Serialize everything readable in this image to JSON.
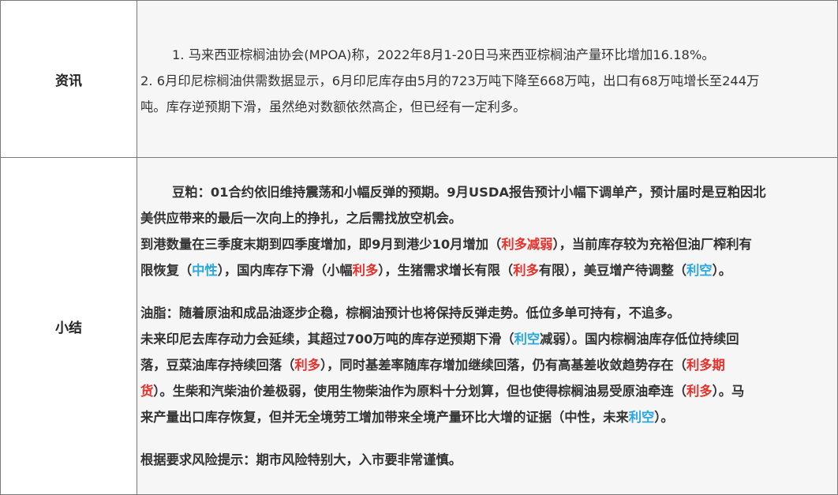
{
  "rows": {
    "info": {
      "label": "资讯",
      "lines": [
        "1. 马来西亚棕榈油协会(MPOA)称，2022年8月1-20日马来西亚棕榈油产量环比增加16.18%。",
        "2. 6月印尼棕榈油供需数据显示，6月印尼库存由5月的723万吨下降至668万吨，出口有68万吨增长至244万",
        "吨。库存逆预期下滑，虽然绝对数额依然高企，但已经有一定利多。"
      ]
    },
    "summary": {
      "label": "小结",
      "soy_l1": "豆粕：01合约依旧维持震荡和小幅反弹的预期。9月USDA报告预计小幅下调单产，预计届时是豆粕因北",
      "soy_l2": "美供应带来的最后一次向上的挣扎，之后需找放空机会。",
      "soy_l3a": "到港数量在三季度末期到四季度增加，即9月到港少10月增加（",
      "soy_l3_red": "利多",
      "soy_l3_blue": "减弱",
      "soy_l3b": "），当前库存较为充裕但油厂榨利有",
      "soy_l4a": "限恢复（",
      "soy_l4_blue1": "中性",
      "soy_l4b": "），国内库存下滑（小幅",
      "soy_l4_red1": "利多",
      "soy_l4c": "），生猪需求增长有限（",
      "soy_l4_red2": "利多",
      "soy_l4d": "有限），美豆增产待调整（",
      "soy_l4_blue2": "利空",
      "soy_l4e": "）。",
      "oil_l1": "油脂：随着原油和成品油逐步企稳，棕榈油预计也将保持反弹走势。低位多单可持有，不追多。",
      "oil_l2a": "未来印尼去库存动力会延续，其超过700万吨的库存逆预期下滑（",
      "oil_l2_blue": "利空",
      "oil_l2b": "减弱）。国内棕榈油库存低位持续回",
      "oil_l3a": "落，豆菜油库存持续回落（",
      "oil_l3_red1": "利多",
      "oil_l3b": "），同时基差率随库存增加继续回落，仍有高基差收敛趋势存在（",
      "oil_l3_red2": "利多期",
      "oil_l4_red0": "货",
      "oil_l4a": "）。生柴和汽柴油价差极弱，使用生物柴油作为原料十分划算，但也使得棕榈油易受原油牵连（",
      "oil_l4_red1": "利多",
      "oil_l4b": "）。马",
      "oil_l5a": "来产量出口库存恢复，但并无全境劳工增加带来全境产量环比大增的证据（中性，未来",
      "oil_l5_blue": "利空",
      "oil_l5b": "）。",
      "risk": "根据要求风险提示：期市风险特别大，入市要非常谨慎。"
    }
  },
  "colors": {
    "bullish": "#e6312c",
    "bearish": "#29a8e0"
  }
}
